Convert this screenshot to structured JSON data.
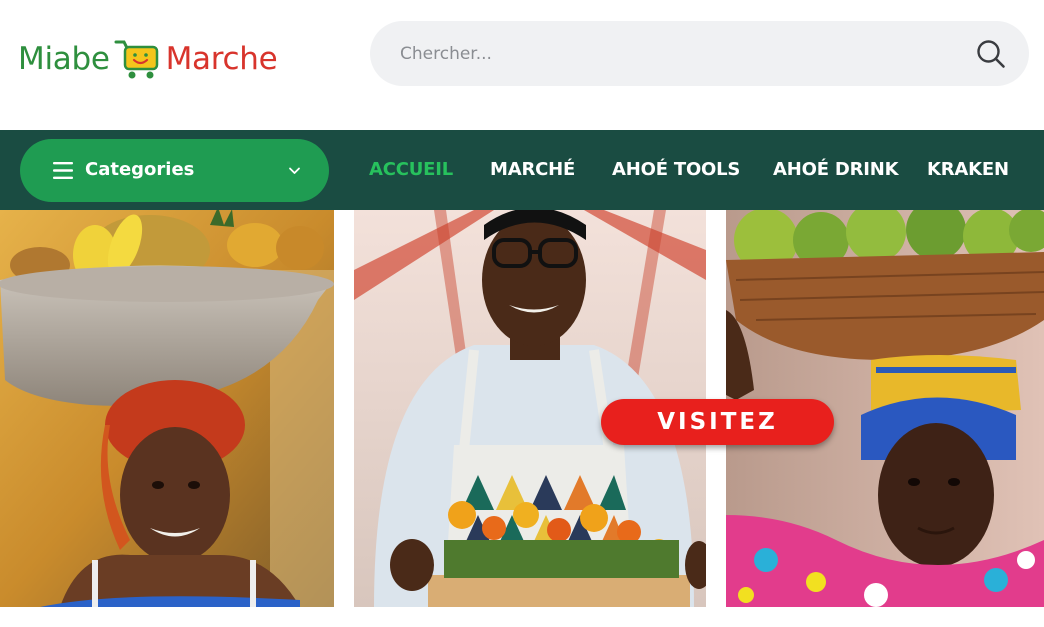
{
  "brand": {
    "name_left": "Miabe",
    "name_right": "Marche",
    "green": "#2e8f3e",
    "red": "#d8342c",
    "cart_icon": "shopping-cart-smiley-icon"
  },
  "search": {
    "placeholder": "Chercher...",
    "value": "",
    "icon": "search-icon"
  },
  "nav": {
    "background": "#1a4c42",
    "categories": {
      "label": "Categories",
      "color": "#1f9c52",
      "icon": "hamburger-icon",
      "dropdown_icon": "chevron-down-icon"
    },
    "items": [
      {
        "label": "ACCUEIL",
        "active": true
      },
      {
        "label": "MARCHÉ",
        "active": false
      },
      {
        "label": "AHOÉ TOOLS",
        "active": false
      },
      {
        "label": "AHOÉ DRINK",
        "active": false
      },
      {
        "label": "KRAKEN",
        "active": false
      }
    ],
    "active_color": "#27c15d"
  },
  "banner": {
    "cta_label": "VISITEZ",
    "cta_color": "#e8201d",
    "panels": [
      {
        "subject": "woman-carrying-fruit-basin-photo"
      },
      {
        "subject": "vendor-with-flower-box-photo"
      },
      {
        "subject": "woman-carrying-fruit-basket-photo"
      }
    ]
  }
}
